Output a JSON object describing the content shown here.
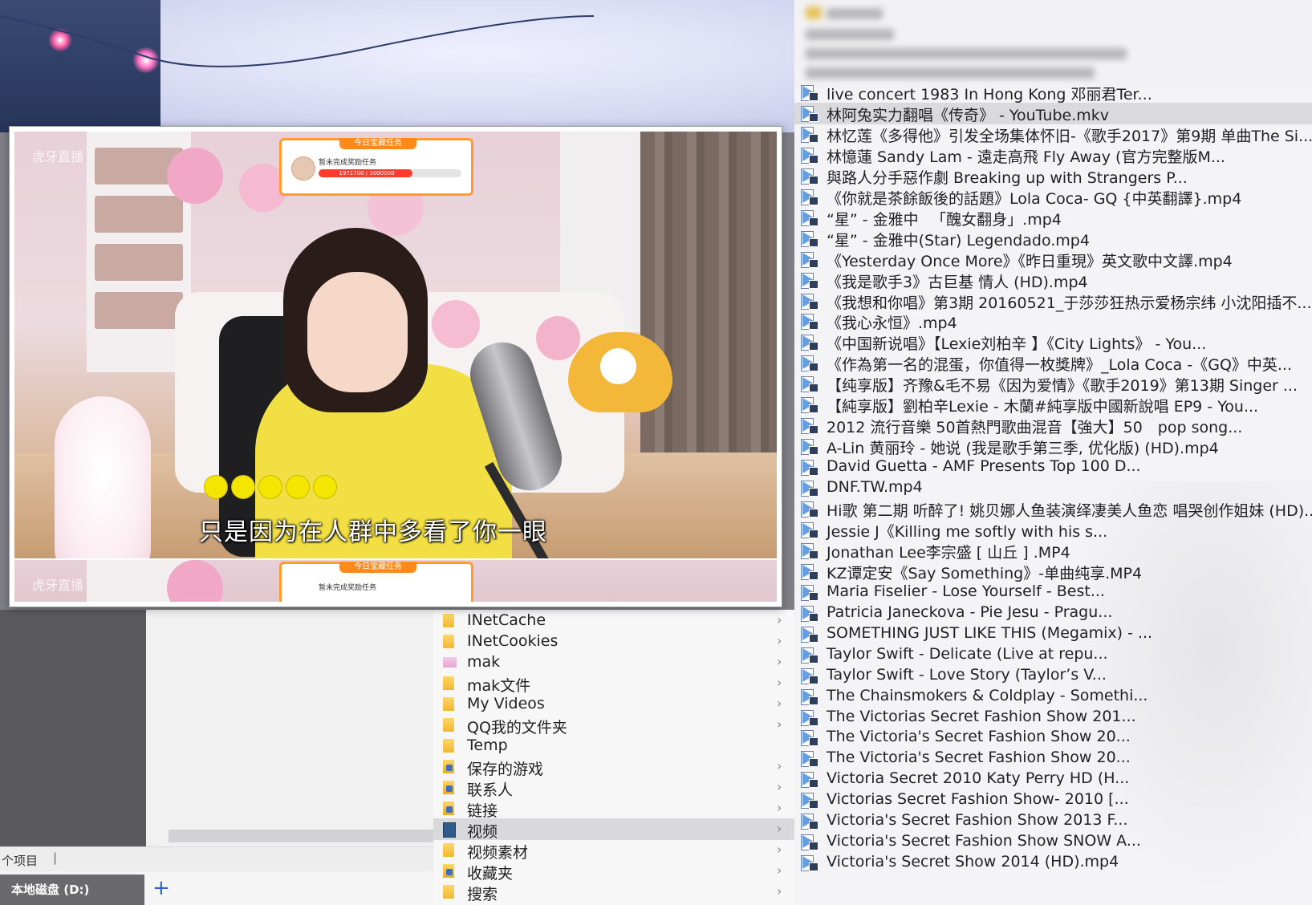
{
  "explorer_left": {
    "status_count": "个项目",
    "status_sep": "|",
    "drive_tab": "本地磁盘 (D:)",
    "add_tab": "+"
  },
  "folder_tree": [
    {
      "label": "INetCache",
      "icon": "folder",
      "chevron": true
    },
    {
      "label": "INetCookies",
      "icon": "folder",
      "chevron": true
    },
    {
      "label": "mak",
      "icon": "folder-pink",
      "chevron": true
    },
    {
      "label": "mak文件",
      "icon": "folder",
      "chevron": true
    },
    {
      "label": "My Videos",
      "icon": "folder",
      "chevron": true
    },
    {
      "label": "QQ我的文件夹",
      "icon": "folder",
      "chevron": true
    },
    {
      "label": "Temp",
      "icon": "folder",
      "chevron": false
    },
    {
      "label": "保存的游戏",
      "icon": "special",
      "chevron": true
    },
    {
      "label": "联系人",
      "icon": "special",
      "chevron": true
    },
    {
      "label": "链接",
      "icon": "special",
      "chevron": true
    },
    {
      "label": "视频",
      "icon": "video",
      "chevron": true,
      "selected": true
    },
    {
      "label": "视频素材",
      "icon": "folder",
      "chevron": true
    },
    {
      "label": "收藏夹",
      "icon": "special",
      "chevron": true
    },
    {
      "label": "搜索",
      "icon": "folder",
      "chevron": true
    }
  ],
  "file_list": [
    "live concert 1983 In Hong Kong 邓丽君Ter...",
    "林阿兔实力翻唱《传奇》 - YouTube.mkv",
    "林忆莲《多得他》引发全场集体怀旧-《歌手2017》第9期 单曲The Si...",
    "林憶蓮 Sandy Lam - 遠走高飛 Fly Away (官方完整版M...",
    "與路人分手惡作劇 Breaking up with Strangers P...",
    "《你就是茶餘飯後的話題》Lola Coca- GQ {中英翻譯}.mp4",
    "“星” - 金雅中 　「醜女翻身」.mp4",
    "“星” - 金雅中(Star) Legendado.mp4",
    "《Yesterday Once More》《昨日重現》英文歌中文譯.mp4",
    "《我是歌手3》古巨基 情人 (HD).mp4",
    "《我想和你唱》第3期 20160521_于莎莎狂热示爱杨宗纬 小沈阳插不...",
    "《我心永恒》.mp4",
    "《中国新说唱》【Lexie刘柏辛 】《City Lights》 - You...",
    "《作為第一名的混蛋，你值得一枚獎牌》_Lola Coca -《GQ》中英...",
    "【纯享版】齐豫&毛不易《因为爱情》《歌手2019》第13期 Singer ...",
    "【純享版】劉柏辛Lexie - 木蘭#純享版中國新說唱 EP9 - You...",
    "2012 流行音樂 50首熱門歌曲混音【強大】50　pop song...",
    "A-Lin 黄丽玲 - 她说 (我是歌手第三季, 优化版) (HD).mp4",
    "David Guetta - AMF Presents Top 100 D...",
    "DNF.TW.mp4",
    "Hi歌 第二期 听醉了! 姚贝娜人鱼装演绎凄美人鱼恋 唱哭创作姐妹 (HD)...",
    "Jessie J《Killing me softly with his s...",
    "Jonathan Lee李宗盛 [ 山丘 ] .MP4",
    "KZ谭定安《Say Something》-单曲纯享.MP4",
    "Maria Fiselier - Lose Yourself - Best...",
    "Patricia Janeckova - Pie Jesu - Pragu...",
    "SOMETHING JUST LIKE THIS (Megamix) - ...",
    "Taylor Swift - Delicate (Live at repu...",
    "Taylor Swift - Love Story (Taylor’s V...",
    "The Chainsmokers & Coldplay - Somethi...",
    "The Victorias Secret Fashion Show 201...",
    "The Victoria's Secret Fashion Show 20...",
    "The Victoria's Secret Fashion Show 20...",
    "Victoria Secret 2010 Katy Perry HD (H...",
    "Victorias Secret Fashion Show- 2010 [...",
    "Victoria's Secret Fashion Show 2013 F...",
    "Victoria's Secret Fashion Show SNOW A...",
    "Victoria's Secret Show 2014 (HD).mp4"
  ],
  "selected_file_index": 1,
  "player": {
    "subtitle": "只是因为在人群中多看了你一眼",
    "watermark": "虎牙直播",
    "task_card_title": "今日宝藏任务",
    "task_card_text": "暂未完成奖励任务",
    "task_progress_text": "1971700 / 3000000",
    "task_progress_fraction": 0.657,
    "dots_count": 5,
    "accent_yellow": "#f4e600",
    "card_orange": "#ff9a2c"
  }
}
